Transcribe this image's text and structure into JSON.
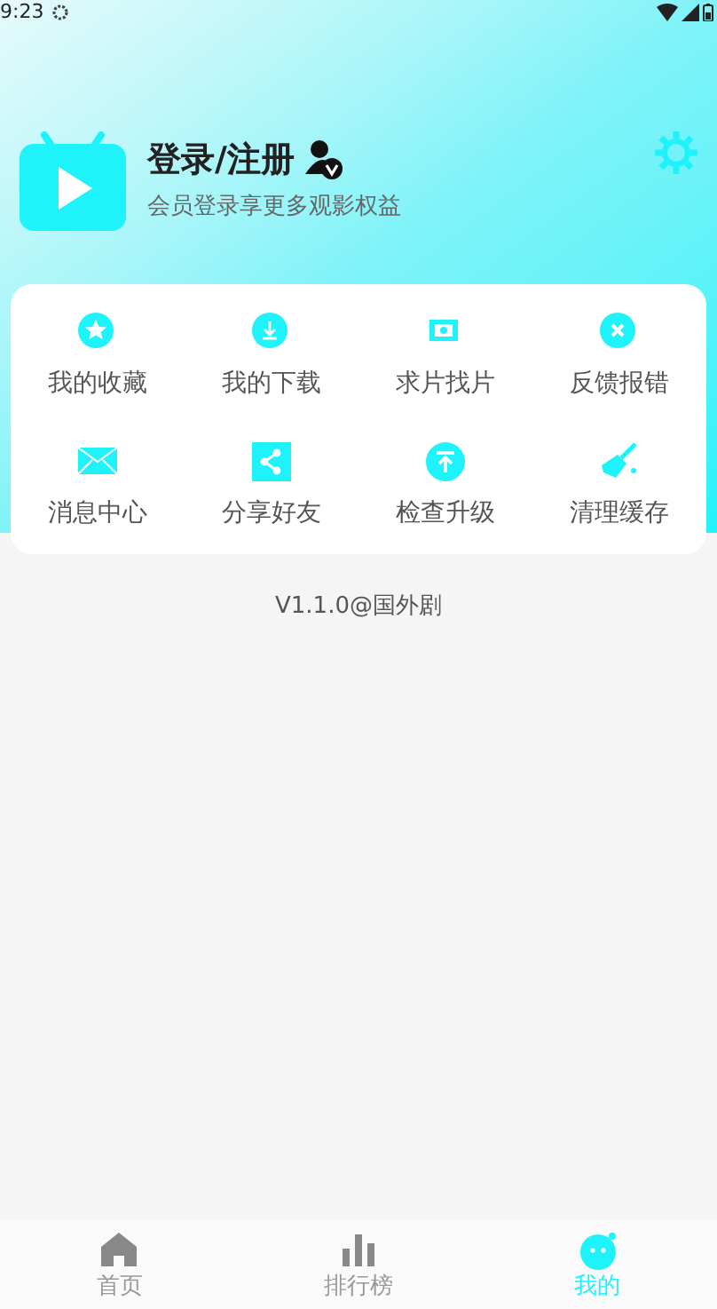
{
  "status_bar": {
    "time": "9:23"
  },
  "profile": {
    "title": "登录/注册",
    "subtitle": "会员登录享更多观影权益"
  },
  "menu": [
    {
      "kind": "star",
      "label": "我的收藏"
    },
    {
      "kind": "download",
      "label": "我的下载"
    },
    {
      "kind": "film",
      "label": "求片找片"
    },
    {
      "kind": "close",
      "label": "反馈报错"
    },
    {
      "kind": "mail",
      "label": "消息中心"
    },
    {
      "kind": "share",
      "label": "分享好友"
    },
    {
      "kind": "upgrade",
      "label": "检查升级"
    },
    {
      "kind": "broom",
      "label": "清理缓存"
    }
  ],
  "version": "V1.1.0@国外剧",
  "tabs": [
    {
      "kind": "home",
      "label": "首页",
      "selected": false
    },
    {
      "kind": "chart",
      "label": "排行榜",
      "selected": false
    },
    {
      "kind": "face",
      "label": "我的",
      "selected": true
    }
  ]
}
